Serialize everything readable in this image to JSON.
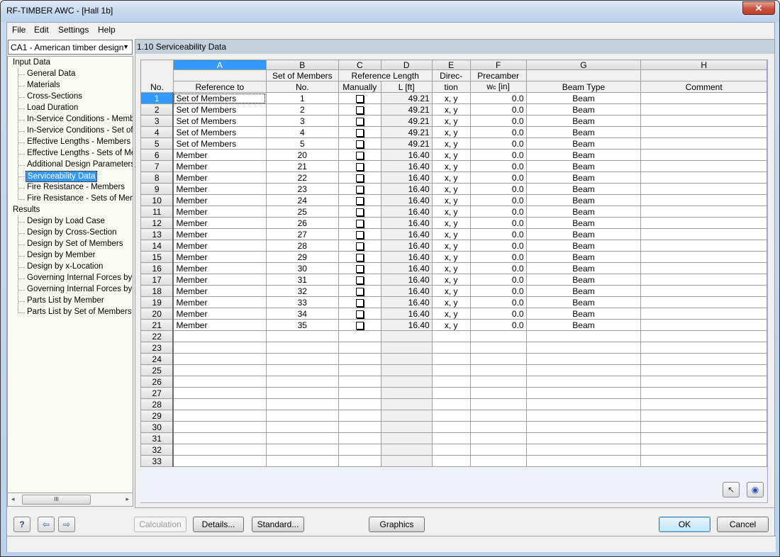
{
  "window": {
    "title": "RF-TIMBER AWC - [Hall 1b]",
    "close_glyph": "✕"
  },
  "menu": [
    "File",
    "Edit",
    "Settings",
    "Help"
  ],
  "case_selector": {
    "value": "CA1 - American timber design",
    "arrow": "▼"
  },
  "navigator": {
    "groups": [
      {
        "label": "Input Data",
        "items": [
          "General Data",
          "Materials",
          "Cross-Sections",
          "Load Duration",
          "In-Service Conditions - Members",
          "In-Service Conditions - Set of Members",
          "Effective Lengths - Members",
          "Effective Lengths - Sets of Members",
          "Additional Design Parameters",
          "Serviceability Data",
          "Fire Resistance - Members",
          "Fire Resistance - Sets of Members"
        ],
        "selected_index": 9
      },
      {
        "label": "Results",
        "items": [
          "Design by Load Case",
          "Design by Cross-Section",
          "Design by Set of Members",
          "Design by Member",
          "Design by x-Location",
          "Governing Internal Forces by Member",
          "Governing Internal Forces by Set of Members",
          "Parts List by Member",
          "Parts List by Set of Members"
        ]
      }
    ],
    "scroll": {
      "left": "◂",
      "thumb": "III",
      "right": "▸"
    }
  },
  "section": {
    "title": "1.10  Serviceability Data"
  },
  "table": {
    "column_letters": [
      "A",
      "B",
      "C",
      "D",
      "E",
      "F",
      "G",
      "H"
    ],
    "active_column": "A",
    "headers": {
      "no": "No.",
      "A": [
        "",
        "Reference to"
      ],
      "B": [
        "Set of Members",
        "No."
      ],
      "CD_group": "Reference Length",
      "C": "Manually",
      "D": "L [ft]",
      "E": [
        "Direc-",
        "tion"
      ],
      "F": [
        "Precamber",
        "w",
        "c",
        " [in]"
      ],
      "G": [
        "",
        "Beam Type"
      ],
      "H": [
        "",
        "Comment"
      ]
    },
    "rows": [
      {
        "no": "1",
        "ref": "Set of Members",
        "num": "1",
        "manual": false,
        "L": "49.21",
        "dir": "x, y",
        "wc": "0.0",
        "beam": "Beam",
        "comment": ""
      },
      {
        "no": "2",
        "ref": "Set of Members",
        "num": "2",
        "manual": false,
        "L": "49.21",
        "dir": "x, y",
        "wc": "0.0",
        "beam": "Beam",
        "comment": ""
      },
      {
        "no": "3",
        "ref": "Set of Members",
        "num": "3",
        "manual": false,
        "L": "49.21",
        "dir": "x, y",
        "wc": "0.0",
        "beam": "Beam",
        "comment": ""
      },
      {
        "no": "4",
        "ref": "Set of Members",
        "num": "4",
        "manual": false,
        "L": "49.21",
        "dir": "x, y",
        "wc": "0.0",
        "beam": "Beam",
        "comment": ""
      },
      {
        "no": "5",
        "ref": "Set of Members",
        "num": "5",
        "manual": false,
        "L": "49.21",
        "dir": "x, y",
        "wc": "0.0",
        "beam": "Beam",
        "comment": ""
      },
      {
        "no": "6",
        "ref": "Member",
        "num": "20",
        "manual": false,
        "L": "16.40",
        "dir": "x, y",
        "wc": "0.0",
        "beam": "Beam",
        "comment": ""
      },
      {
        "no": "7",
        "ref": "Member",
        "num": "21",
        "manual": false,
        "L": "16.40",
        "dir": "x, y",
        "wc": "0.0",
        "beam": "Beam",
        "comment": ""
      },
      {
        "no": "8",
        "ref": "Member",
        "num": "22",
        "manual": false,
        "L": "16.40",
        "dir": "x, y",
        "wc": "0.0",
        "beam": "Beam",
        "comment": ""
      },
      {
        "no": "9",
        "ref": "Member",
        "num": "23",
        "manual": false,
        "L": "16.40",
        "dir": "x, y",
        "wc": "0.0",
        "beam": "Beam",
        "comment": ""
      },
      {
        "no": "10",
        "ref": "Member",
        "num": "24",
        "manual": false,
        "L": "16.40",
        "dir": "x, y",
        "wc": "0.0",
        "beam": "Beam",
        "comment": ""
      },
      {
        "no": "11",
        "ref": "Member",
        "num": "25",
        "manual": false,
        "L": "16.40",
        "dir": "x, y",
        "wc": "0.0",
        "beam": "Beam",
        "comment": ""
      },
      {
        "no": "12",
        "ref": "Member",
        "num": "26",
        "manual": false,
        "L": "16.40",
        "dir": "x, y",
        "wc": "0.0",
        "beam": "Beam",
        "comment": ""
      },
      {
        "no": "13",
        "ref": "Member",
        "num": "27",
        "manual": false,
        "L": "16.40",
        "dir": "x, y",
        "wc": "0.0",
        "beam": "Beam",
        "comment": ""
      },
      {
        "no": "14",
        "ref": "Member",
        "num": "28",
        "manual": false,
        "L": "16.40",
        "dir": "x, y",
        "wc": "0.0",
        "beam": "Beam",
        "comment": ""
      },
      {
        "no": "15",
        "ref": "Member",
        "num": "29",
        "manual": false,
        "L": "16.40",
        "dir": "x, y",
        "wc": "0.0",
        "beam": "Beam",
        "comment": ""
      },
      {
        "no": "16",
        "ref": "Member",
        "num": "30",
        "manual": false,
        "L": "16.40",
        "dir": "x, y",
        "wc": "0.0",
        "beam": "Beam",
        "comment": ""
      },
      {
        "no": "17",
        "ref": "Member",
        "num": "31",
        "manual": false,
        "L": "16.40",
        "dir": "x, y",
        "wc": "0.0",
        "beam": "Beam",
        "comment": ""
      },
      {
        "no": "18",
        "ref": "Member",
        "num": "32",
        "manual": false,
        "L": "16.40",
        "dir": "x, y",
        "wc": "0.0",
        "beam": "Beam",
        "comment": ""
      },
      {
        "no": "19",
        "ref": "Member",
        "num": "33",
        "manual": false,
        "L": "16.40",
        "dir": "x, y",
        "wc": "0.0",
        "beam": "Beam",
        "comment": ""
      },
      {
        "no": "20",
        "ref": "Member",
        "num": "34",
        "manual": false,
        "L": "16.40",
        "dir": "x, y",
        "wc": "0.0",
        "beam": "Beam",
        "comment": ""
      },
      {
        "no": "21",
        "ref": "Member",
        "num": "35",
        "manual": false,
        "L": "16.40",
        "dir": "x, y",
        "wc": "0.0",
        "beam": "Beam",
        "comment": ""
      }
    ],
    "empty_row_numbers": [
      "22",
      "23",
      "24",
      "25",
      "26",
      "27",
      "28",
      "29",
      "30",
      "31",
      "32",
      "33"
    ]
  },
  "grid_tools": {
    "select_glyph": "↖",
    "view_glyph": "◉"
  },
  "footer": {
    "icons": {
      "help": "?",
      "prev": "⇦",
      "next": "⇨"
    },
    "calculation": "Calculation",
    "details": "Details...",
    "standard": "Standard...",
    "graphics": "Graphics",
    "ok": "OK",
    "cancel": "Cancel"
  },
  "colors": {
    "selection": "#3399ff",
    "section_header": "#c3d1dd",
    "close_button": "#c7503c"
  }
}
